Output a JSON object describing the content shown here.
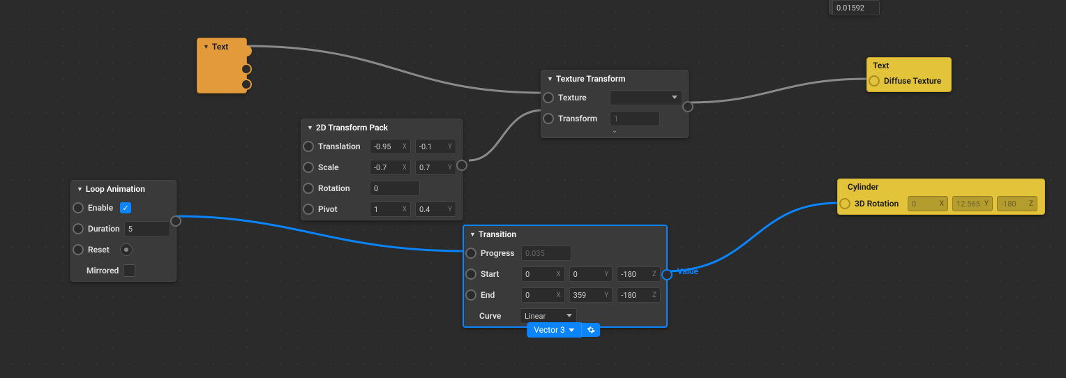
{
  "cropped_top_value": "0.01592",
  "text_node": {
    "title": "Text"
  },
  "loop_node": {
    "title": "Loop Animation",
    "enable_label": "Enable",
    "enable_checked": true,
    "duration_label": "Duration",
    "duration_val": "5",
    "reset_label": "Reset",
    "mirrored_label": "Mirrored",
    "mirrored_checked": false
  },
  "transform2d": {
    "title": "2D Transform Pack",
    "translation_label": "Translation",
    "translation_x": "-0.95",
    "translation_y": "-0.1",
    "scale_label": "Scale",
    "scale_x": "-0.7",
    "scale_y": "0.7",
    "rotation_label": "Rotation",
    "rotation_val": "0",
    "pivot_label": "Pivot",
    "pivot_x": "1",
    "pivot_y": "0.4"
  },
  "texture_transform": {
    "title": "Texture Transform",
    "texture_label": "Texture",
    "transform_label": "Transform",
    "transform_val": "1"
  },
  "transition": {
    "title": "Transition",
    "progress_label": "Progress",
    "progress_val": "0.035",
    "start_label": "Start",
    "start_x": "0",
    "start_y": "0",
    "start_z": "-180",
    "end_label": "End",
    "end_x": "0",
    "end_y": "359",
    "end_z": "-180",
    "curve_label": "Curve",
    "curve_val": "Linear",
    "out_label": "Value"
  },
  "diffuse_node": {
    "title": "Text",
    "sub": "Diffuse Texture"
  },
  "cylinder": {
    "title": "Cylinder",
    "rot_label": "3D Rotation",
    "rot_x": "0",
    "rot_y": "12.565",
    "rot_z": "-180"
  },
  "footer_chip": "Vector 3",
  "axis": {
    "x": "X",
    "y": "Y",
    "z": "Z"
  }
}
